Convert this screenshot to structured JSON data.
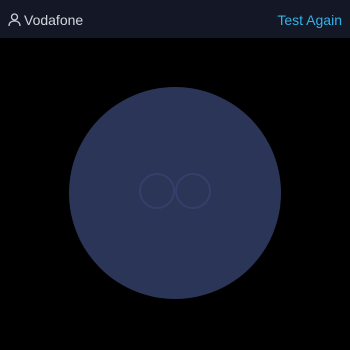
{
  "header": {
    "provider_name": "Vodafone",
    "test_again_label": "Test Again",
    "provider_icon": "user-icon"
  },
  "gauge": {
    "faint_label": "",
    "center_mark": "GO"
  },
  "colors": {
    "background": "#000000",
    "topbar": "#141726",
    "accent": "#2fb3ea",
    "circle": "#2b3558"
  }
}
